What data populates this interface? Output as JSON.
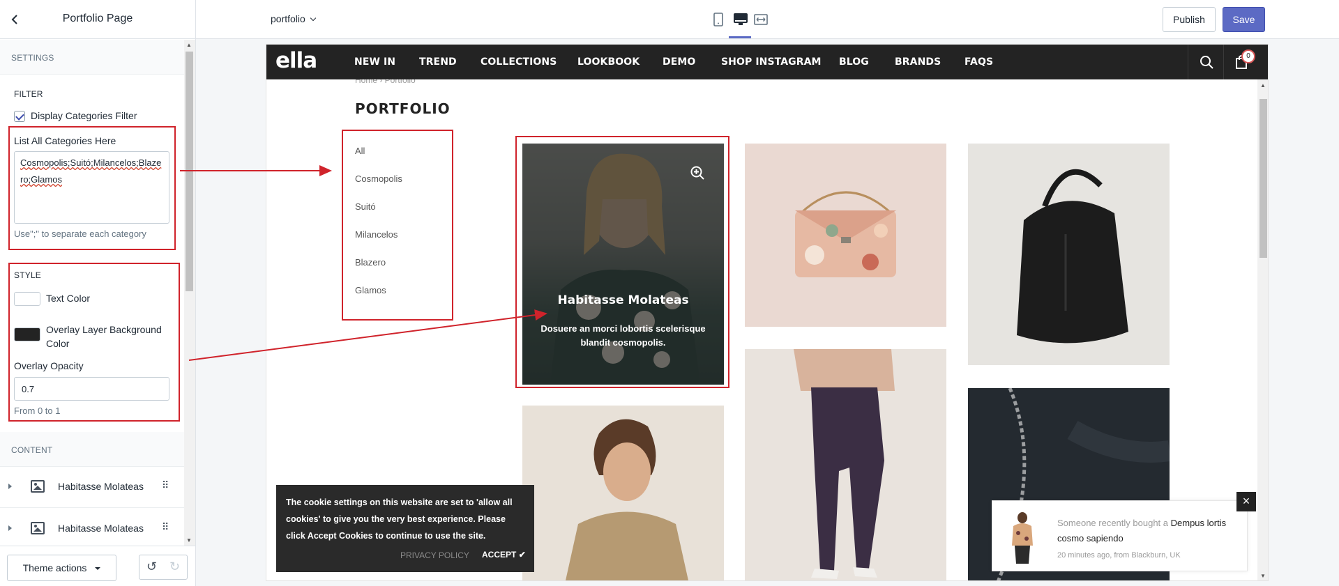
{
  "editor": {
    "title": "Portfolio Page",
    "page_select": "portfolio",
    "publish_label": "Publish",
    "save_label": "Save",
    "theme_actions_label": "Theme actions"
  },
  "settings": {
    "section_label": "SETTINGS",
    "filter": {
      "heading": "FILTER",
      "display_categories_label": "Display Categories Filter",
      "display_categories_checked": true,
      "list_label": "List All Categories Here",
      "list_value": "Cosmopolis;Suitó;Milancelos;Blazero;Glamos",
      "list_hint": "Use\";\" to separate each category"
    },
    "style": {
      "heading": "STYLE",
      "text_color_label": "Text Color",
      "text_color_value": "#ffffff",
      "overlay_bg_label": "Overlay Layer Background Color",
      "overlay_bg_value": "#232323",
      "overlay_opacity_label": "Overlay Opacity",
      "overlay_opacity_value": "0.7",
      "overlay_opacity_hint": "From 0 to 1"
    },
    "content": {
      "heading": "CONTENT",
      "blocks": [
        "Habitasse Molateas",
        "Habitasse Molateas"
      ]
    }
  },
  "store": {
    "logo": "ella",
    "nav": [
      "NEW IN",
      "TREND",
      "COLLECTIONS",
      "LOOKBOOK",
      "DEMO",
      "SHOP INSTAGRAM",
      "BLOG",
      "BRANDS",
      "FAQS"
    ],
    "cart_count": "0",
    "breadcrumb": "Home  ›  Portfolio",
    "page_title": "PORTFOLIO",
    "categories": [
      "All",
      "Cosmopolis",
      "Suitó",
      "Milancelos",
      "Blazero",
      "Glamos"
    ],
    "featured": {
      "title": "Habitasse Molateas",
      "description": "Dosuere an morci lobortis scelerisque blandit cosmopolis."
    },
    "cookie": {
      "text": "The cookie settings on this website are set to 'allow all cookies' to give you the very best experience. Please click Accept Cookies to continue to use the site.",
      "privacy_label": "PRIVACY POLICY",
      "accept_label": "ACCEPT"
    },
    "toast": {
      "prefix": "Someone recently bought a",
      "product": "Dempus lortis cosmo sapiendo",
      "time": "20 minutes ago,  from Blackburn, UK"
    }
  },
  "colors": {
    "accent": "#5c6ac4",
    "annotation_red": "#d0232b",
    "nav_bg": "#232323"
  }
}
